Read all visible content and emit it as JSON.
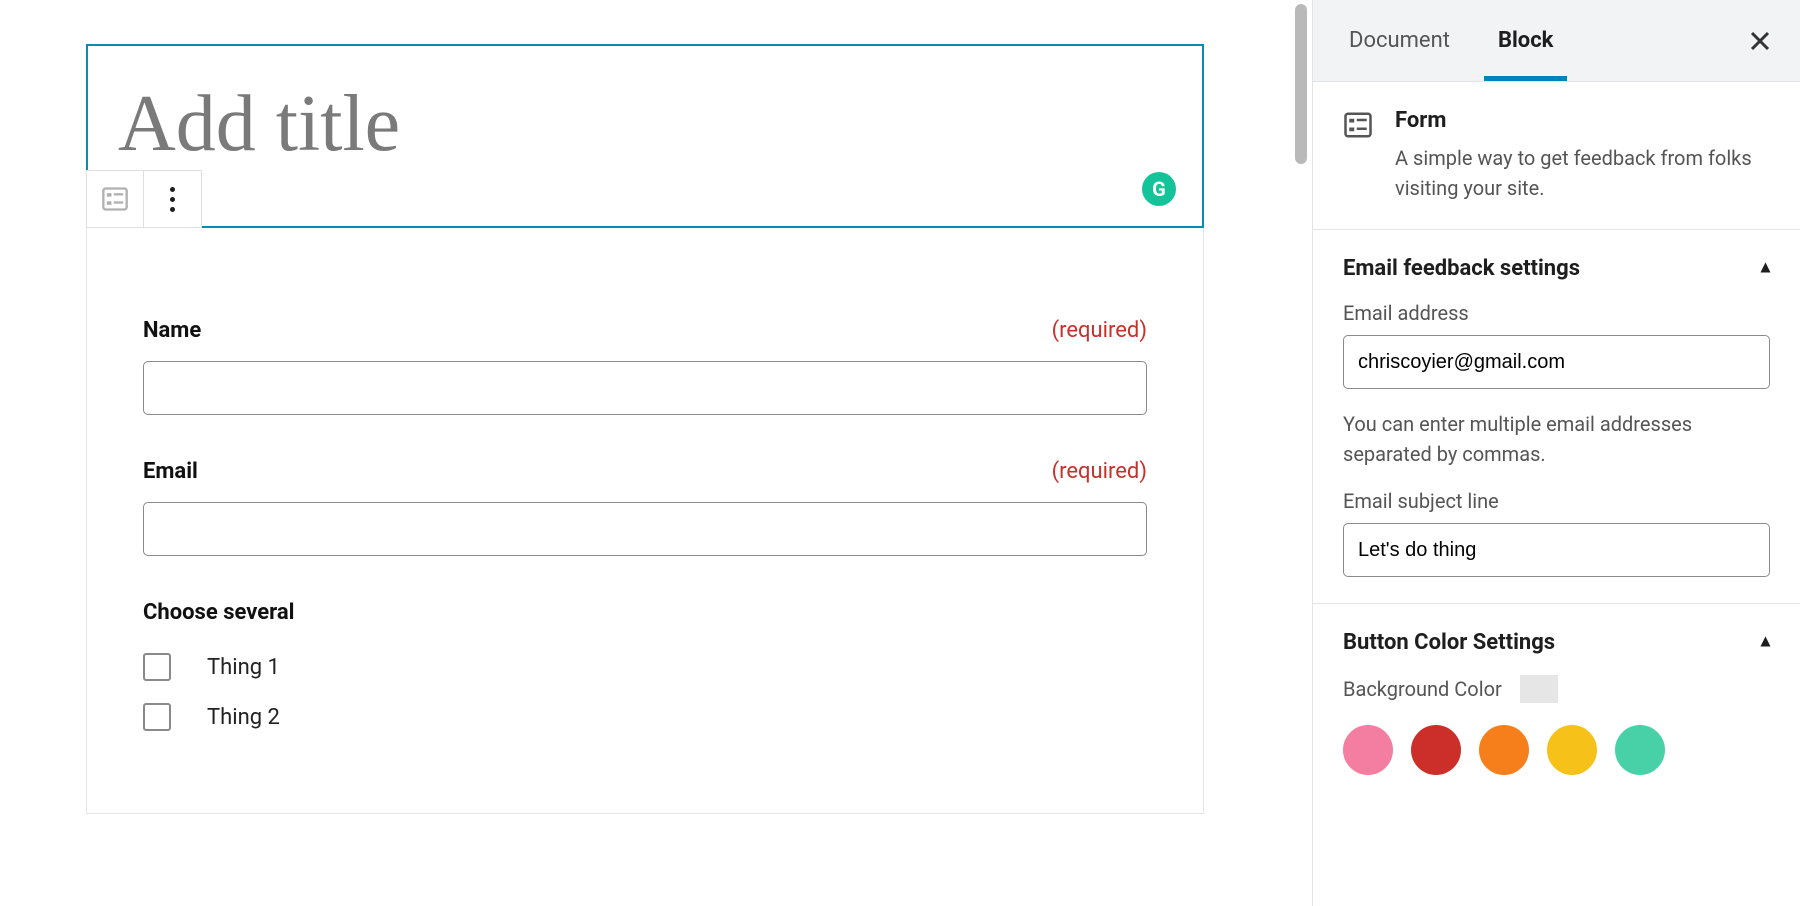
{
  "editor": {
    "title_placeholder": "Add title",
    "form": {
      "fields": [
        {
          "label": "Name",
          "required_text": "(required)"
        },
        {
          "label": "Email",
          "required_text": "(required)"
        }
      ],
      "checkbox_group": {
        "label": "Choose several",
        "options": [
          "Thing 1",
          "Thing 2"
        ]
      }
    },
    "grammarly_badge": "G"
  },
  "sidebar": {
    "tabs": {
      "document": "Document",
      "block": "Block"
    },
    "block_info": {
      "title": "Form",
      "description": "A simple way to get feedback from folks visiting your site."
    },
    "email_settings": {
      "section_title": "Email feedback settings",
      "address_label": "Email address",
      "address_value": "chriscoyier@gmail.com",
      "address_hint": "You can enter multiple email addresses separated by commas.",
      "subject_label": "Email subject line",
      "subject_value": "Let's do thing"
    },
    "button_color": {
      "section_title": "Button Color Settings",
      "bg_label": "Background Color",
      "swatches": [
        "#f37ea1",
        "#cc2f2a",
        "#f77f1b",
        "#f6c21a",
        "#48d1a7"
      ]
    }
  }
}
